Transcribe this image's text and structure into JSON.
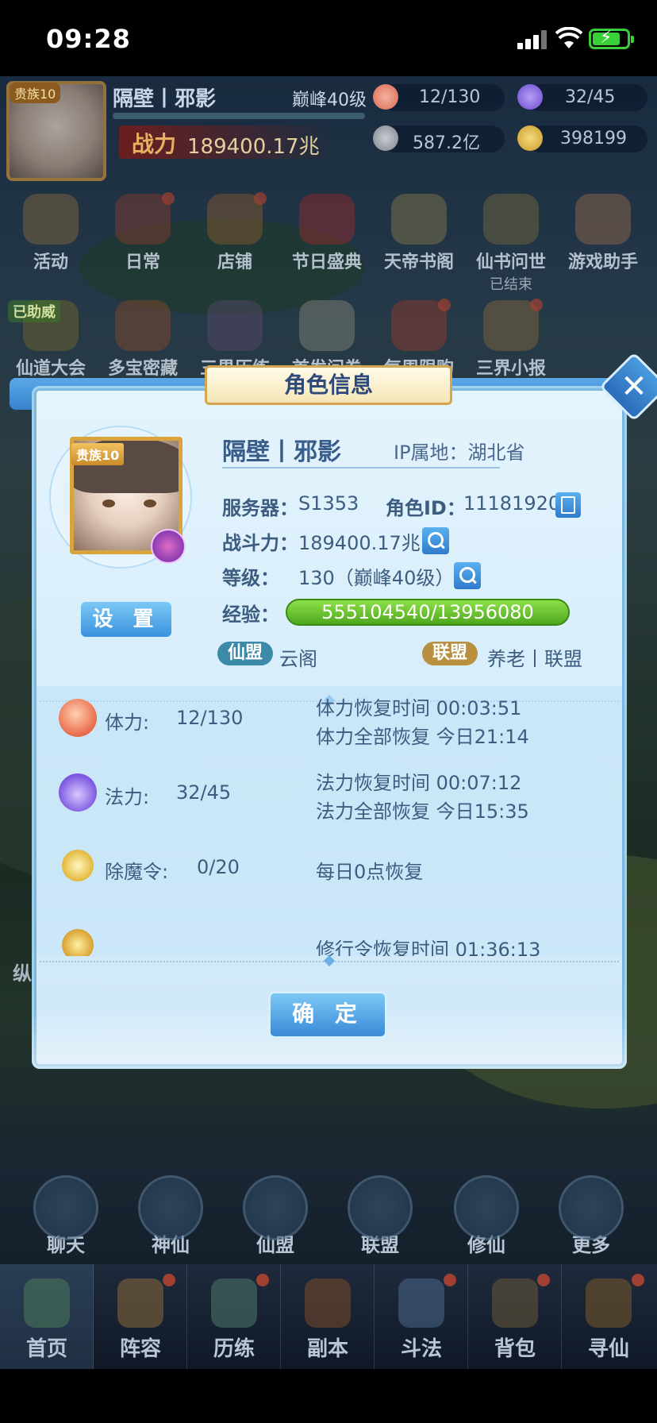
{
  "status_bar": {
    "time": "09:28"
  },
  "hud": {
    "vip": "贵族10",
    "name": "隔壁丨邪影",
    "level": "巅峰40级",
    "power_label": "战力",
    "power_value": "189400.17兆",
    "resources": {
      "stamina": "12/130",
      "mana": "32/45",
      "coins": "587.2亿",
      "ingots": "398199"
    }
  },
  "menu_row1": [
    {
      "label": "活动"
    },
    {
      "label": "日常"
    },
    {
      "label": "店铺"
    },
    {
      "label": "节日盛典"
    },
    {
      "label": "天帝书阁"
    },
    {
      "label": "仙书问世",
      "sub": "已结束"
    },
    {
      "label": "游戏助手"
    }
  ],
  "menu_row2": [
    {
      "label": "仙道大会",
      "tag": "已助威"
    },
    {
      "label": "多宝密藏"
    },
    {
      "label": "三界历练"
    },
    {
      "label": "首发问卷"
    },
    {
      "label": "每周限购"
    },
    {
      "label": "三界小报"
    }
  ],
  "side": {
    "zongheng": "纵横三界"
  },
  "round_buttons": [
    {
      "label": "聊天"
    },
    {
      "label": "神仙"
    },
    {
      "label": "仙盟"
    },
    {
      "label": "联盟"
    },
    {
      "label": "修仙"
    },
    {
      "label": "更多"
    }
  ],
  "bottom_nav": [
    {
      "label": "首页"
    },
    {
      "label": "阵容"
    },
    {
      "label": "历练"
    },
    {
      "label": "副本"
    },
    {
      "label": "斗法"
    },
    {
      "label": "背包"
    },
    {
      "label": "寻仙"
    }
  ],
  "dialog": {
    "title": "角色信息",
    "vip_badge": "贵族10",
    "settings_button": "设 置",
    "player_name": "隔壁丨邪影",
    "ip_location": "IP属地：湖北省",
    "server_label": "服务器：",
    "server_value": "S1353",
    "role_id_label": "角色ID：",
    "role_id_value": "11181920",
    "power_label": "战斗力：",
    "power_value": "189400.17兆",
    "level_label": "等级：",
    "level_value": "130（巅峰40级）",
    "exp_label": "经验：",
    "exp_value": "555104540/13956080",
    "guild_tag": "仙盟",
    "guild_name": "云阁",
    "alliance_tag": "联盟",
    "alliance_name": "养老丨联盟",
    "stats": [
      {
        "icon": "peach-icon",
        "label": "体力:",
        "value": "12/130",
        "note1": "体力恢复时间 00:03:51",
        "note2": "体力全部恢复 今日21:14"
      },
      {
        "icon": "flame-icon",
        "label": "法力:",
        "value": "32/45",
        "note1": "法力恢复时间 00:07:12",
        "note2": "法力全部恢复 今日15:35"
      },
      {
        "icon": "token-icon",
        "label": "除魔令:",
        "value": "0/20",
        "note1": "每日0点恢复"
      },
      {
        "icon": "practice-icon",
        "note1": "修行令恢复时间 01:36:13"
      }
    ],
    "confirm_button": "确 定"
  },
  "colors": {
    "accent": "#3a92de",
    "xp_green": "#6cc832",
    "title_gold": "#d4a650",
    "text": "#3c5c80"
  }
}
